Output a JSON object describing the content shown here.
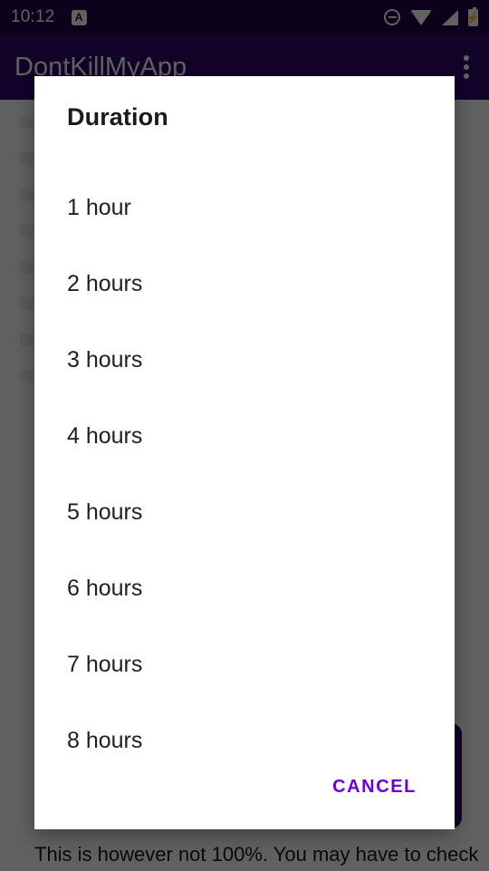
{
  "status_bar": {
    "time": "10:12",
    "notification_icon_label": "A",
    "icons": {
      "do_not_disturb": "do-not-disturb-icon",
      "wifi": "wifi-icon",
      "cellular": "cellular-signal-icon",
      "battery": "battery-charging-icon"
    },
    "background_color": "#20074a"
  },
  "app_bar": {
    "title": "DontKillMyApp",
    "overflow_menu_label": "More options",
    "background_color": "#30086c"
  },
  "dialog": {
    "title": "Duration",
    "options": [
      {
        "label": "1 hour"
      },
      {
        "label": "2 hours"
      },
      {
        "label": "3 hours"
      },
      {
        "label": "4 hours"
      },
      {
        "label": "5 hours"
      },
      {
        "label": "6 hours"
      },
      {
        "label": "7 hours"
      },
      {
        "label": "8 hours"
      }
    ],
    "cancel_label": "CANCEL",
    "accent_color": "#6a00e0",
    "background_color": "#ffffff"
  },
  "background_content": {
    "bottom_text": "This is however not 100%. You may have to check"
  }
}
